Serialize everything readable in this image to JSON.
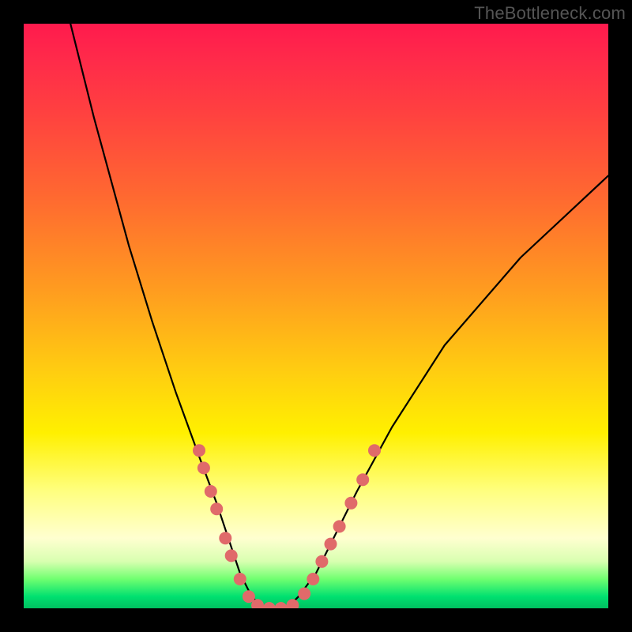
{
  "watermark": "TheBottleneck.com",
  "colors": {
    "frame": "#000000",
    "curve": "#000000",
    "dot": "#e06a6a",
    "gradient_top": "#ff1a4d",
    "gradient_mid": "#ffff00",
    "gradient_bottom": "#00c060"
  },
  "chart_data": {
    "type": "line",
    "title": "",
    "xlabel": "",
    "ylabel": "",
    "xlim": [
      0,
      100
    ],
    "ylim": [
      0,
      100
    ],
    "description": "V-shaped bottleneck curve on a vertical red→yellow→green gradient. The curve plunges from near top-left, touches zero around x≈38–47, then rises toward the top-right. Salmon dots cluster on both flanks and the floor of the V.",
    "series": [
      {
        "name": "bottleneck_curve",
        "x": [
          8,
          10,
          12,
          15,
          18,
          22,
          26,
          30,
          33,
          35,
          37,
          39,
          41,
          43,
          45,
          47,
          50,
          53,
          57,
          63,
          72,
          85,
          100
        ],
        "y": [
          100,
          92,
          84,
          73,
          62,
          49,
          37,
          26,
          18,
          12,
          6,
          2,
          0,
          0,
          0,
          2,
          6,
          12,
          20,
          31,
          45,
          60,
          74
        ]
      }
    ],
    "dots": [
      {
        "x": 30.0,
        "y": 27
      },
      {
        "x": 30.8,
        "y": 24
      },
      {
        "x": 32.0,
        "y": 20
      },
      {
        "x": 33.0,
        "y": 17
      },
      {
        "x": 34.5,
        "y": 12
      },
      {
        "x": 35.5,
        "y": 9
      },
      {
        "x": 37.0,
        "y": 5
      },
      {
        "x": 38.5,
        "y": 2
      },
      {
        "x": 40.0,
        "y": 0.5
      },
      {
        "x": 42.0,
        "y": 0
      },
      {
        "x": 44.0,
        "y": 0
      },
      {
        "x": 46.0,
        "y": 0.5
      },
      {
        "x": 48.0,
        "y": 2.5
      },
      {
        "x": 49.5,
        "y": 5
      },
      {
        "x": 51.0,
        "y": 8
      },
      {
        "x": 52.5,
        "y": 11
      },
      {
        "x": 54.0,
        "y": 14
      },
      {
        "x": 56.0,
        "y": 18
      },
      {
        "x": 58.0,
        "y": 22
      },
      {
        "x": 60.0,
        "y": 27
      }
    ],
    "dot_radius_px": 8
  }
}
